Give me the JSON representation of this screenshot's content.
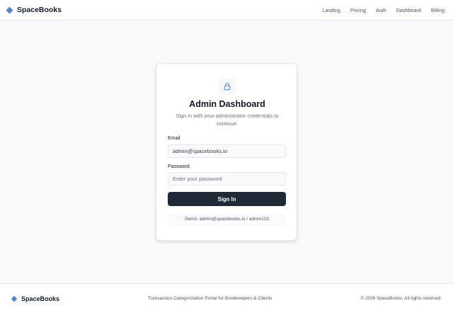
{
  "header": {
    "brand": "SpaceBooks",
    "nav": [
      "Landing",
      "Pricing",
      "Auth",
      "Dashboard",
      "Billing"
    ]
  },
  "card": {
    "icon": "lock-icon",
    "title": "Admin Dashboard",
    "subtitle": "Sign in with your administrator credentials to continue.",
    "email_label": "Email",
    "email_value": "admin@spacebooks.io",
    "password_label": "Password",
    "password_placeholder": "Enter your password",
    "signin_label": "Sign In",
    "demo_text": "Demo: admin@spacebooks.io / admin123"
  },
  "footer": {
    "brand": "SpaceBooks",
    "tagline": "Transaction Categorization Portal for Bookkeepers & Clients",
    "copyright": "© 2026 SpaceBooks. All rights reserved."
  },
  "colors": {
    "accent": "#4f86d9",
    "button": "#1f2937",
    "background": "#f8f9fb"
  }
}
